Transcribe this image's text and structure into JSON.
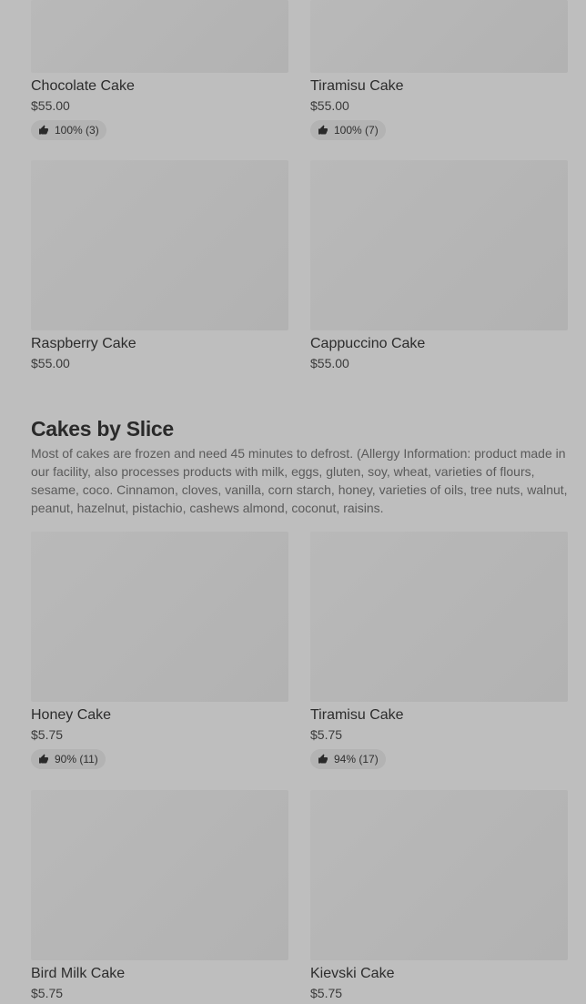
{
  "top_products": [
    {
      "name": "Chocolate Cake",
      "price": "$55.00",
      "rating": "100% (3)"
    },
    {
      "name": "Tiramisu Cake",
      "price": "$55.00",
      "rating": "100% (7)"
    },
    {
      "name": "Raspberry Cake",
      "price": "$55.00"
    },
    {
      "name": "Cappuccino Cake",
      "price": "$55.00"
    }
  ],
  "slice_section": {
    "title": "Cakes by Slice",
    "description": "Most of cakes are frozen and need 45 minutes to defrost. (Allergy Information: product made in our facility, also processes products with milk, eggs, gluten, soy, wheat, varieties of flours, sesame, coco. Cinnamon, cloves, vanilla, corn starch, honey, varieties of oils, tree nuts, walnut, peanut, hazelnut, pistachio, cashews almond, coconut, raisins.",
    "products": [
      {
        "name": "Honey Cake",
        "price": "$5.75",
        "rating": "90% (11)"
      },
      {
        "name": "Tiramisu Cake",
        "price": "$5.75",
        "rating": "94% (17)"
      },
      {
        "name": "Bird Milk Cake",
        "price": "$5.75"
      },
      {
        "name": "Kievski Cake",
        "price": "$5.75"
      }
    ]
  },
  "icons": {
    "rating": "thumbs-up-icon"
  }
}
